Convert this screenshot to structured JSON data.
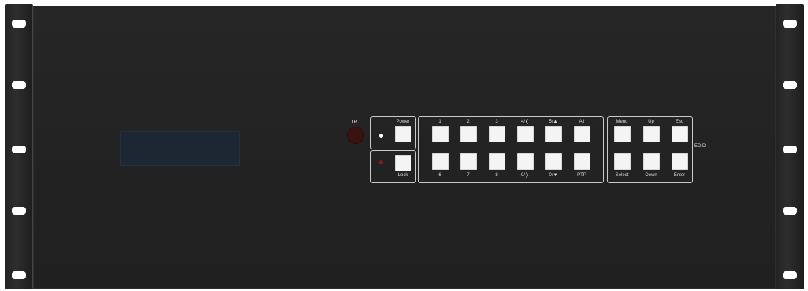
{
  "ir": {
    "label": "IR"
  },
  "power": {
    "label": "Power"
  },
  "lock": {
    "label": "Lock"
  },
  "inputs_top": [
    "1",
    "2",
    "3",
    "4/❮",
    "5/▲",
    "All"
  ],
  "inputs_bottom": [
    "6",
    "7",
    "8",
    "9/❯",
    "0/▼",
    "PTP"
  ],
  "menu_top": [
    "Menu",
    "Up",
    "Esc"
  ],
  "menu_bottom": [
    "Select",
    "Down",
    "Enter"
  ],
  "edid": {
    "label": "EDID"
  },
  "colors": {
    "panel": "#222222",
    "button": "#f4f4f4",
    "lock_led": "#8a1b1b",
    "power_led": "#ffffff"
  }
}
